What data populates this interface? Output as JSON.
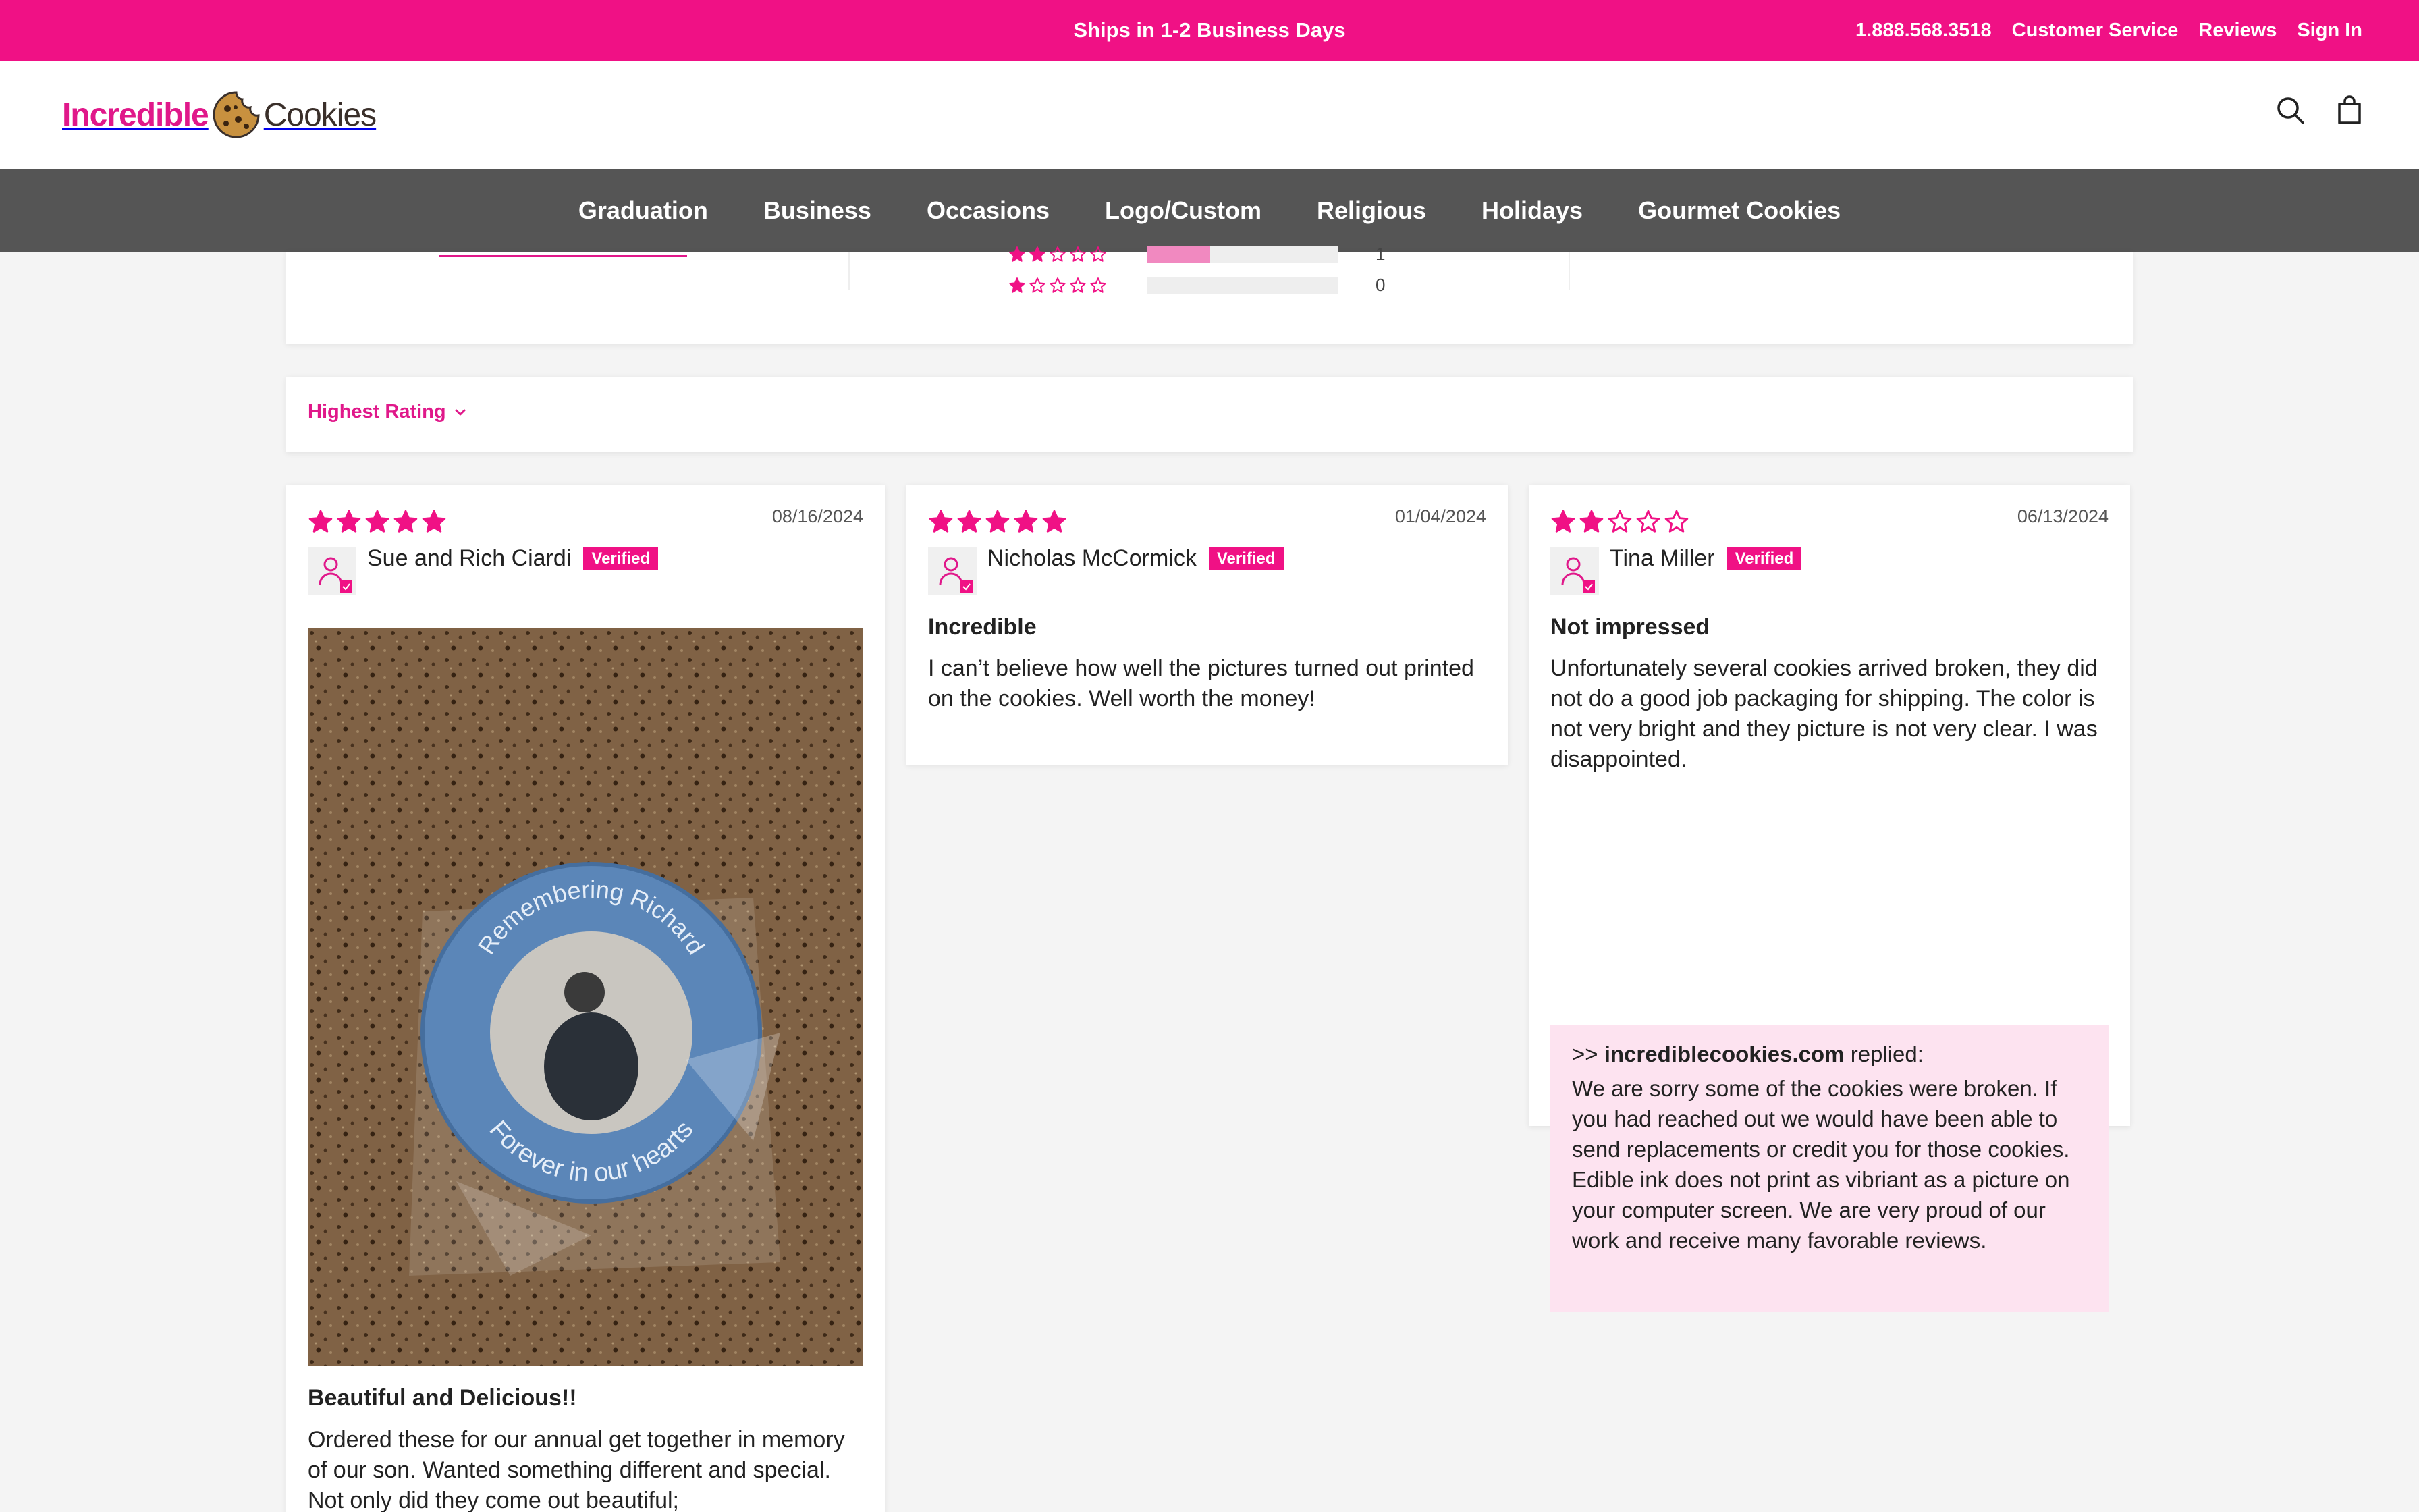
{
  "topbar": {
    "promo": "Ships in 1-2 Business Days",
    "phone": "1.888.568.3518",
    "customer_service": "Customer Service",
    "reviews": "Reviews",
    "sign_in": "Sign In"
  },
  "brand": {
    "name_part1": "Incredible",
    "name_part2": "Cookies",
    "color": "#e0188a"
  },
  "header_icons": [
    "search-icon",
    "bag-icon"
  ],
  "nav": [
    "Graduation",
    "Business",
    "Occasions",
    "Logo/Custom",
    "Religious",
    "Holidays",
    "Gourmet Cookies"
  ],
  "rating_rows": [
    {
      "stars": 2,
      "count": "1",
      "fill": 0.33
    },
    {
      "stars": 1,
      "count": "0",
      "fill": 0
    }
  ],
  "sort": {
    "label": "Highest Rating"
  },
  "reviews": [
    {
      "rating": 5,
      "date": "08/16/2024",
      "author": "Sue and Rich Ciardi",
      "badge": "Verified",
      "photo_text_top": "Remembering Richard",
      "photo_text_bottom": "Forever in our hearts",
      "title": "Beautiful and Delicious!!",
      "body": "Ordered these for our annual get together in memory of our son. Wanted something different and special. Not only did they come out beautiful;"
    },
    {
      "rating": 5,
      "date": "01/04/2024",
      "author": "Nicholas McCormick",
      "badge": "Verified",
      "title": "Incredible",
      "body": "I can’t believe how well the pictures turned out printed on the cookies. Well worth the money!"
    },
    {
      "rating": 2,
      "date": "06/13/2024",
      "author": "Tina Miller",
      "badge": "Verified",
      "title": "Not impressed",
      "body": "Unfortunately several cookies arrived broken, they did not do a good job packaging for shipping. The color is not very bright and they picture is not very clear. I was disappointed.",
      "reply": {
        "prefix": ">>",
        "author": "incrediblecookies.com",
        "suffix": "replied:",
        "body": "We are sorry some of the cookies were broken. If you had reached out we would have been able to send replacements or credit you for those cookies. Edible ink does not print as vibriant as a picture on your computer screen. We are very proud of our work and receive many favorable reviews."
      }
    }
  ],
  "colors": {
    "accent": "#f01185",
    "nav_bg": "#555555",
    "reply_bg": "#fde3f0"
  }
}
